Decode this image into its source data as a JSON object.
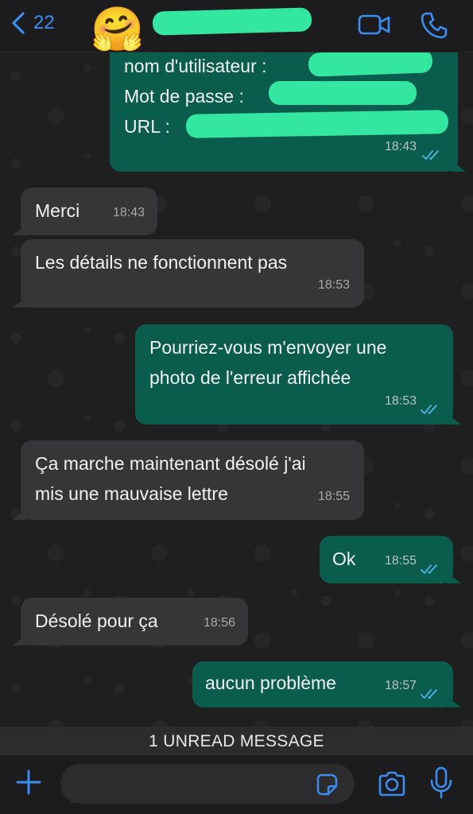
{
  "header": {
    "back_count": "22",
    "avatar_emoji": "🤗",
    "contact_name": "",
    "icons": [
      "chevron-left-icon",
      "video-camera-icon",
      "phone-icon"
    ]
  },
  "messages": [
    {
      "direction": "outgoing",
      "lines": [
        "nom d'utilisateur :",
        "Mot de passe :",
        "URL :"
      ],
      "time": "18:43",
      "read": true
    },
    {
      "direction": "incoming",
      "text": "Merci",
      "time": "18:43"
    },
    {
      "direction": "incoming",
      "text": "Les détails ne fonctionnent pas",
      "time": "18:53"
    },
    {
      "direction": "outgoing",
      "lines": [
        "Pourriez-vous m'envoyer une",
        "photo de l'erreur affichée"
      ],
      "time": "18:53",
      "read": true
    },
    {
      "direction": "incoming",
      "lines": [
        "Ça marche maintenant désolé j'ai",
        "mis une mauvaise lettre"
      ],
      "time": "18:55"
    },
    {
      "direction": "outgoing",
      "text": "Ok",
      "time": "18:55",
      "read": true
    },
    {
      "direction": "incoming",
      "text": "Désolé pour ça",
      "time": "18:56"
    },
    {
      "direction": "outgoing",
      "text": "aucun problème",
      "time": "18:57",
      "read": true
    }
  ],
  "unread_banner": "1 UNREAD MESSAGE",
  "composer": {
    "placeholder": "",
    "icons": [
      "plus-icon",
      "sticker-icon",
      "camera-icon",
      "microphone-icon"
    ]
  },
  "colors": {
    "accent": "#3b8ef0",
    "outgoing_bubble": "#0a5c4c",
    "incoming_bubble": "#363638",
    "redaction": "#33e7a0",
    "read_ticks": "#4fb7f0"
  }
}
